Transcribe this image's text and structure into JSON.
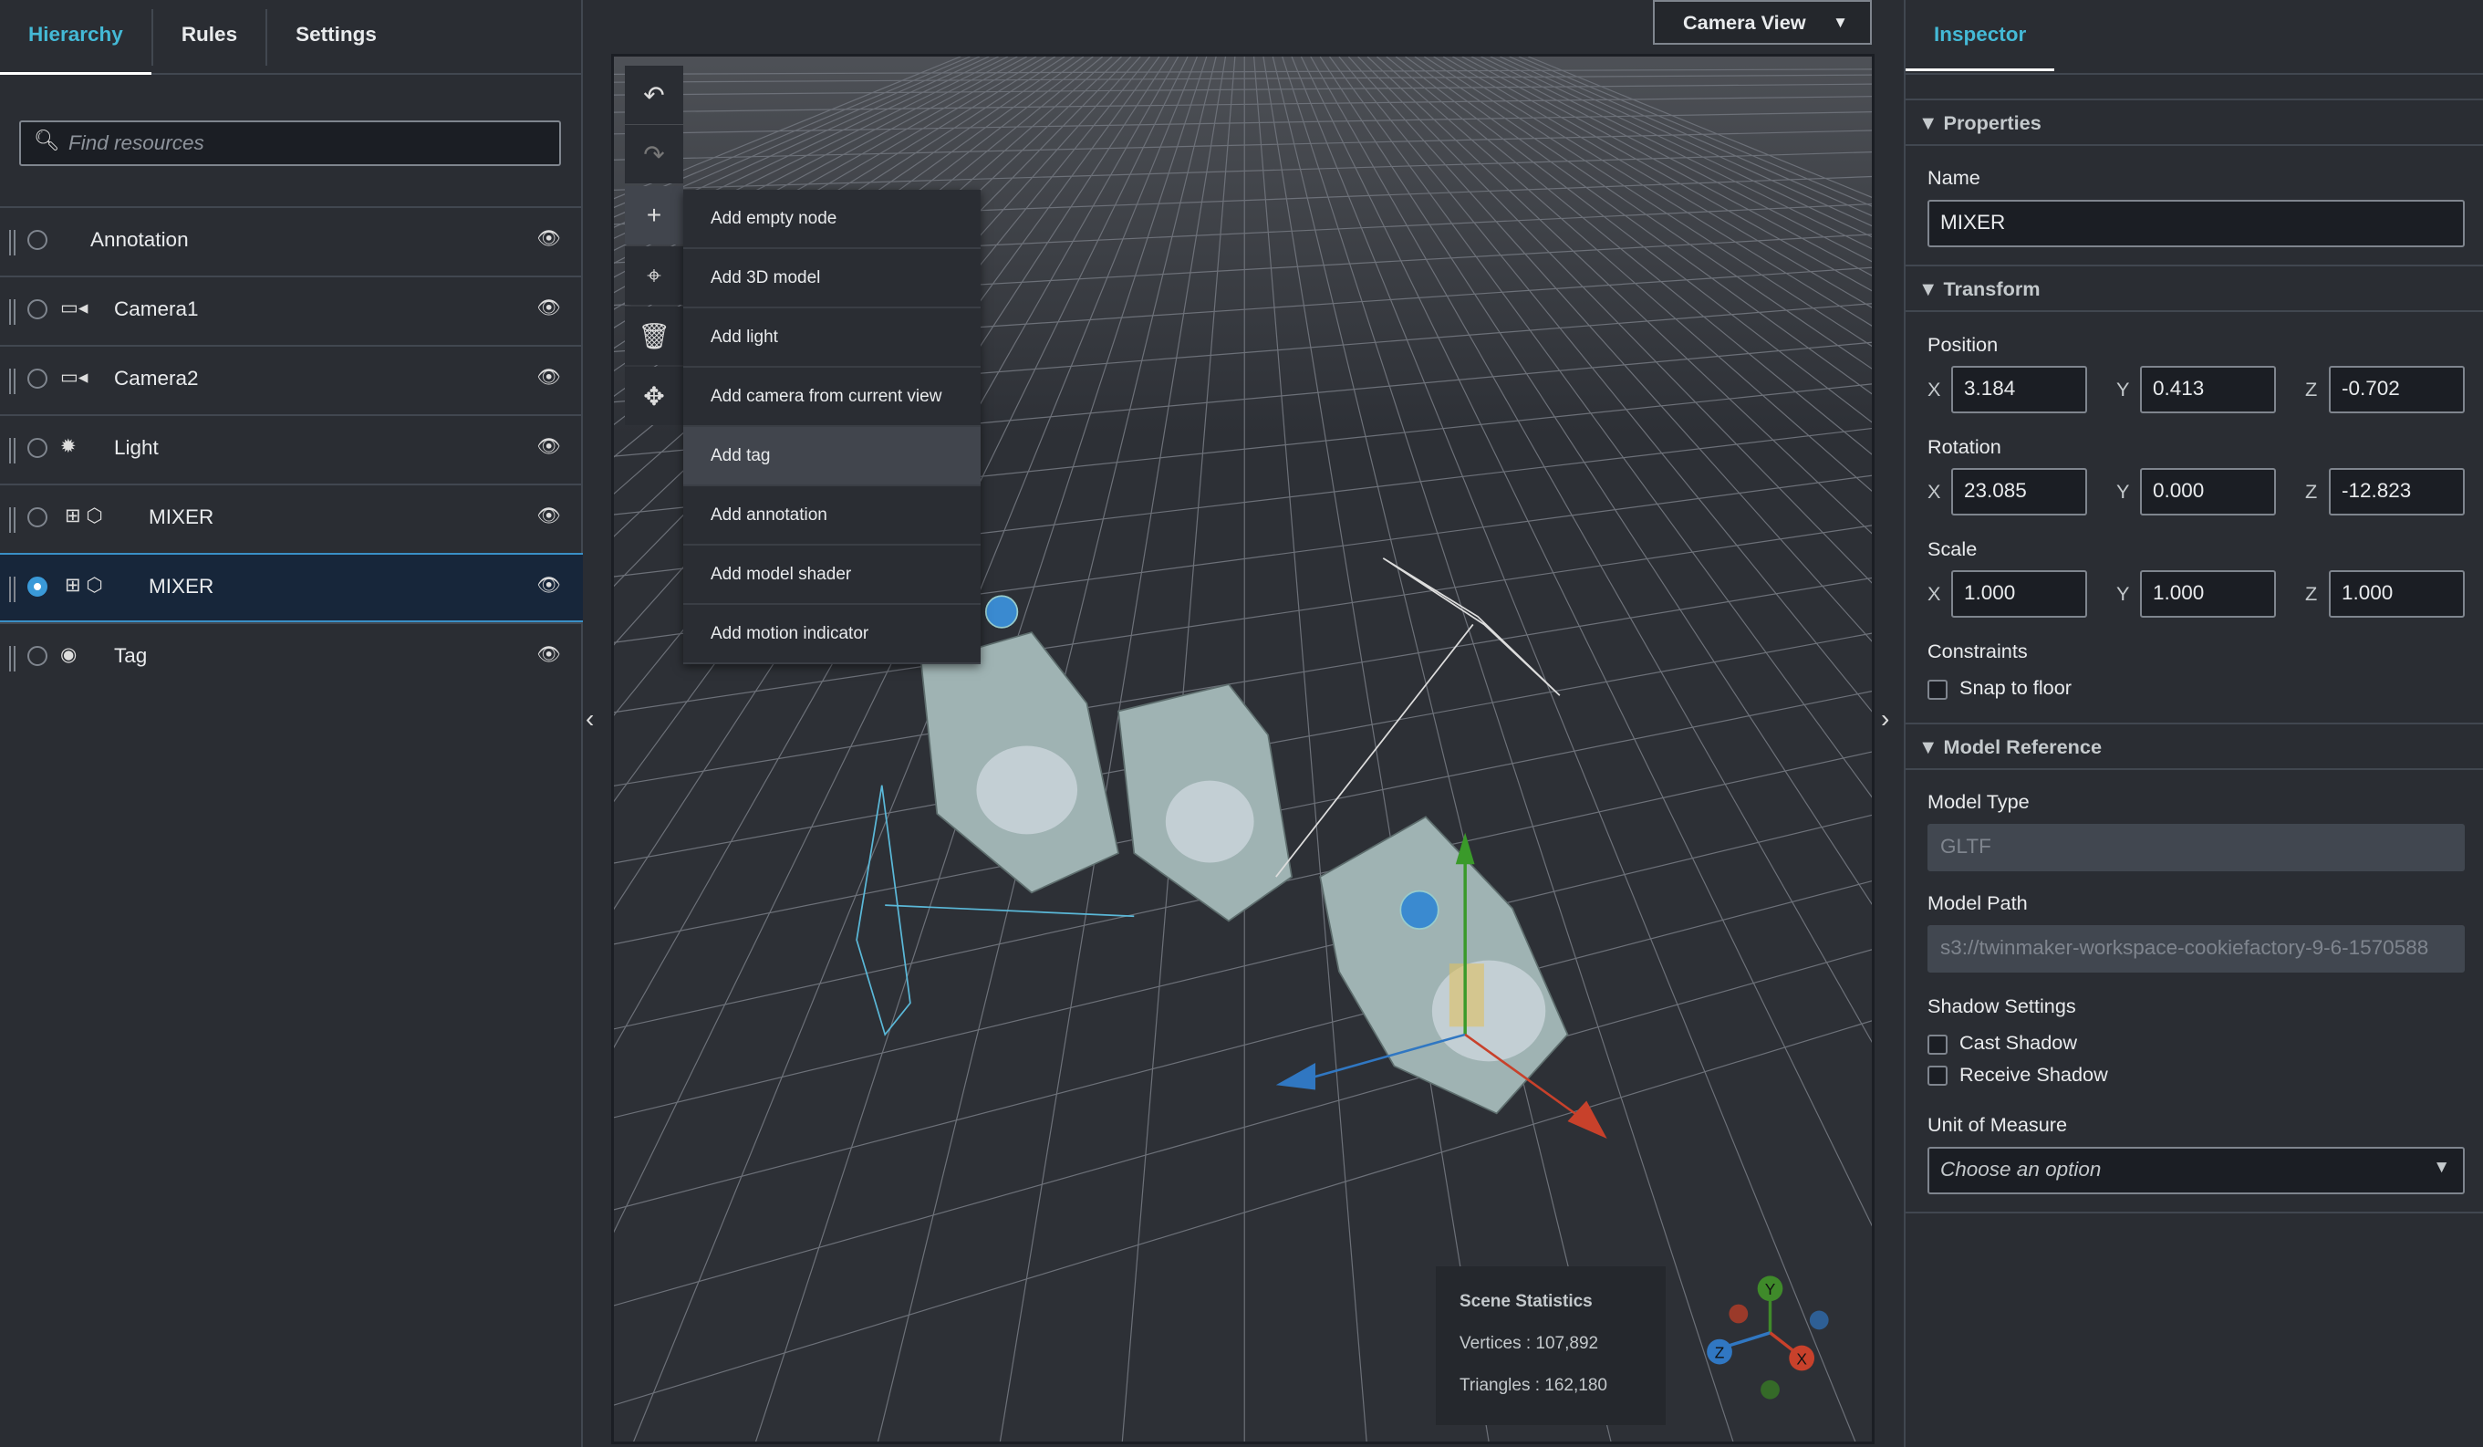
{
  "left_panel": {
    "tabs": [
      "Hierarchy",
      "Rules",
      "Settings"
    ],
    "active_tab": "Hierarchy",
    "search_placeholder": "Find resources",
    "items": [
      {
        "label": "Annotation",
        "icon": "none",
        "selected": false
      },
      {
        "label": "Camera1",
        "icon": "camera-icon",
        "selected": false
      },
      {
        "label": "Camera2",
        "icon": "camera-icon",
        "selected": false
      },
      {
        "label": "Light",
        "icon": "sun-icon",
        "selected": false
      },
      {
        "label": "MIXER",
        "icon": "model-icon",
        "selected": false
      },
      {
        "label": "MIXER",
        "icon": "model-icon",
        "selected": true
      },
      {
        "label": "Tag",
        "icon": "tag-icon",
        "selected": false
      }
    ]
  },
  "viewport": {
    "camera_view": "Camera View",
    "add_menu": [
      "Add empty node",
      "Add 3D model",
      "Add light",
      "Add camera from current view",
      "Add tag",
      "Add annotation",
      "Add model shader",
      "Add motion indicator"
    ],
    "highlighted_menu_item": "Add tag",
    "stats": {
      "title": "Scene Statistics",
      "vertices": "Vertices : 107,892",
      "triangles": "Triangles : 162,180"
    },
    "gizmo": {
      "y": "Y",
      "z": "Z",
      "x": "X"
    }
  },
  "inspector": {
    "tab": "Inspector",
    "properties": {
      "title": "Properties",
      "name_label": "Name",
      "name": "MIXER"
    },
    "transform": {
      "title": "Transform",
      "position_label": "Position",
      "rotation_label": "Rotation",
      "scale_label": "Scale",
      "axes": [
        "X",
        "Y",
        "Z"
      ],
      "position": [
        "3.184",
        "0.413",
        "-0.702"
      ],
      "rotation": [
        "23.085",
        "0.000",
        "-12.823"
      ],
      "scale": [
        "1.000",
        "1.000",
        "1.000"
      ],
      "constraints_label": "Constraints",
      "snap_to_floor": "Snap to floor"
    },
    "model_reference": {
      "title": "Model Reference",
      "model_type_label": "Model Type",
      "model_type": "GLTF",
      "model_path_label": "Model Path",
      "model_path": "s3://twinmaker-workspace-cookiefactory-9-6-1570588",
      "shadow_label": "Shadow Settings",
      "cast_shadow": "Cast Shadow",
      "receive_shadow": "Receive Shadow",
      "unit_label": "Unit of Measure",
      "unit_placeholder": "Choose an option"
    }
  },
  "colors": {
    "accent": "#44b9d6",
    "selection": "#3a9ad9",
    "x_axis": "#c8412b",
    "y_axis": "#3f8a2a",
    "z_axis": "#3077c2"
  }
}
